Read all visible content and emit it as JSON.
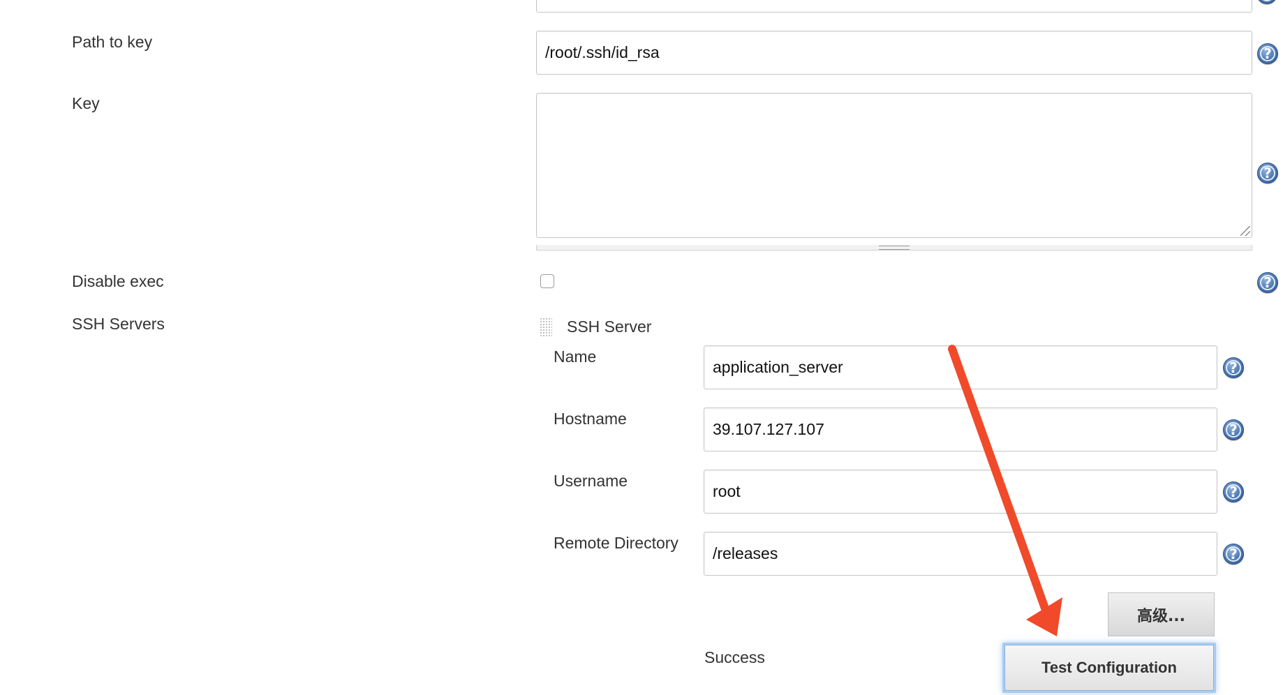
{
  "form": {
    "path_to_key": {
      "label": "Path to key",
      "value": "/root/.ssh/id_rsa"
    },
    "key": {
      "label": "Key",
      "value": ""
    },
    "disable_exec": {
      "label": "Disable exec",
      "checked": false
    },
    "ssh_servers": {
      "label": "SSH Servers"
    }
  },
  "ssh_server": {
    "title": "SSH Server",
    "name": {
      "label": "Name",
      "value": "application_server"
    },
    "hostname": {
      "label": "Hostname",
      "value": "39.107.127.107"
    },
    "username": {
      "label": "Username",
      "value": "root"
    },
    "remote_directory": {
      "label": "Remote Directory",
      "value": "/releases"
    },
    "advanced_label": "高级...",
    "status_text": "Success",
    "test_button_label": "Test Configuration"
  },
  "help_icon_glyph": "?",
  "colors": {
    "annotation_arrow": "#f04a2a",
    "help_icon": "#4a76b3",
    "button_focus": "#a9cdf3"
  }
}
